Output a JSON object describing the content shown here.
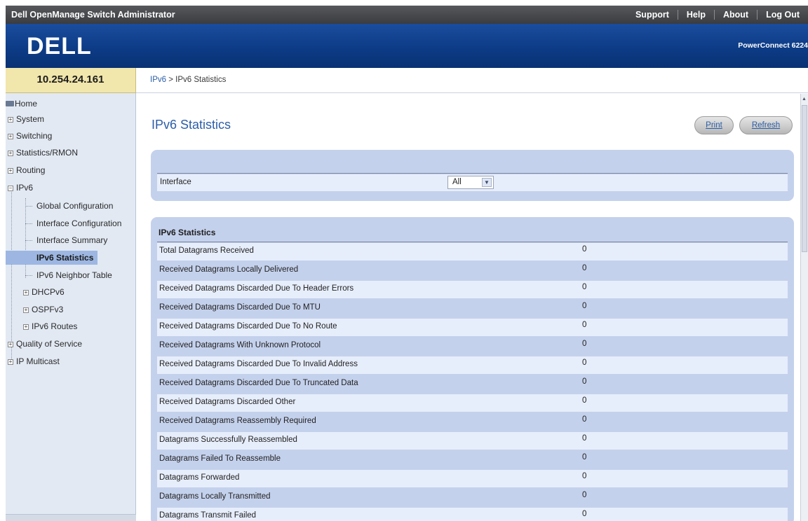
{
  "topbar": {
    "title": "Dell OpenManage Switch Administrator",
    "links": [
      "Support",
      "Help",
      "About",
      "Log Out"
    ]
  },
  "header": {
    "logo_text": "DELL",
    "product": "PowerConnect 6224"
  },
  "ip_address": "10.254.24.161",
  "breadcrumb": {
    "parent": "IPv6",
    "separator": " > ",
    "current": "IPv6 Statistics"
  },
  "sidebar": {
    "items": [
      {
        "label": "Home"
      },
      {
        "label": "System",
        "expander": "+"
      },
      {
        "label": "Switching",
        "expander": "+"
      },
      {
        "label": "Statistics/RMON",
        "expander": "+"
      },
      {
        "label": "Routing",
        "expander": "+"
      },
      {
        "label": "IPv6",
        "expander": "−"
      },
      {
        "label": "Global Configuration"
      },
      {
        "label": "Interface Configuration"
      },
      {
        "label": "Interface Summary"
      },
      {
        "label": "IPv6 Statistics",
        "selected": true
      },
      {
        "label": "IPv6 Neighbor Table"
      },
      {
        "label": "DHCPv6",
        "expander": "+"
      },
      {
        "label": "OSPFv3",
        "expander": "+"
      },
      {
        "label": "IPv6 Routes",
        "expander": "+"
      },
      {
        "label": "Quality of Service",
        "expander": "+"
      },
      {
        "label": "IP Multicast",
        "expander": "+"
      }
    ]
  },
  "page": {
    "title": "IPv6 Statistics",
    "print_label": "Print",
    "refresh_label": "Refresh",
    "interface_label": "Interface",
    "interface_value": "All",
    "stats_title": "IPv6 Statistics"
  },
  "stats": [
    {
      "label": "Total Datagrams Received",
      "value": "0"
    },
    {
      "label": "Received Datagrams Locally Delivered",
      "value": "0"
    },
    {
      "label": "Received Datagrams Discarded Due To Header Errors",
      "value": "0"
    },
    {
      "label": "Received Datagrams Discarded Due To MTU",
      "value": "0"
    },
    {
      "label": "Received Datagrams Discarded Due To No Route",
      "value": "0"
    },
    {
      "label": "Received Datagrams With Unknown Protocol",
      "value": "0"
    },
    {
      "label": "Received Datagrams Discarded Due To Invalid Address",
      "value": "0"
    },
    {
      "label": "Received Datagrams Discarded Due To Truncated Data",
      "value": "0"
    },
    {
      "label": "Received Datagrams Discarded Other",
      "value": "0"
    },
    {
      "label": "Received Datagrams Reassembly Required",
      "value": "0"
    },
    {
      "label": "Datagrams Successfully Reassembled",
      "value": "0"
    },
    {
      "label": "Datagrams Failed To Reassemble",
      "value": "0"
    },
    {
      "label": "Datagrams Forwarded",
      "value": "0"
    },
    {
      "label": "Datagrams Locally Transmitted",
      "value": "0"
    },
    {
      "label": "Datagrams Transmit Failed",
      "value": "0"
    }
  ],
  "colors": {
    "brand_blue": "#0c3a84",
    "panel_blue": "#c4d1ec",
    "row_light": "#e7eefb",
    "ip_box": "#f1e6ab",
    "selected_nav": "#9db7e2"
  }
}
